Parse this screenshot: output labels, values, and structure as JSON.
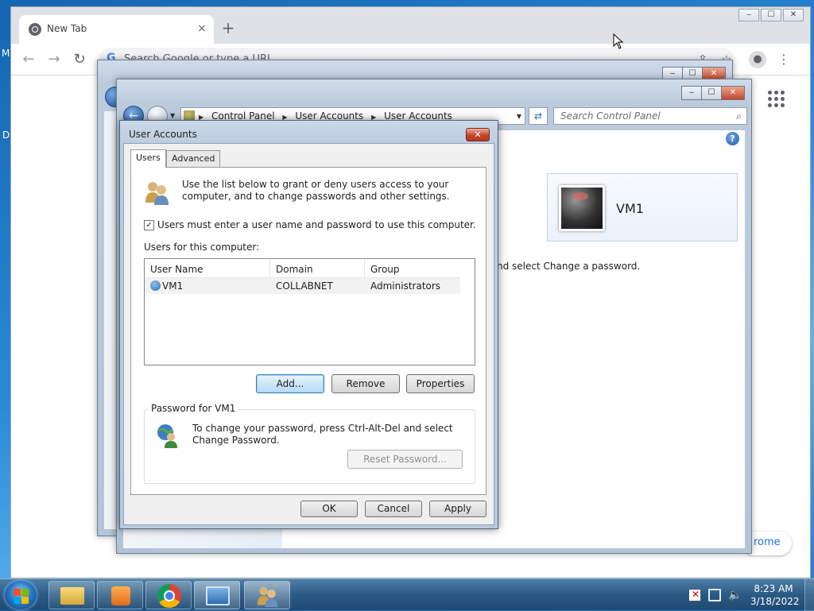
{
  "desktop": {
    "edge_letters": [
      "M",
      "D"
    ]
  },
  "browser": {
    "tab_title": "New Tab",
    "tab_close": "×",
    "new_tab": "+",
    "omnibox_placeholder": "Search Google or type a URL",
    "window_buttons": [
      "‒",
      "☐",
      "✕"
    ],
    "bottom_link": "rome"
  },
  "control_panel": {
    "breadcrumbs": [
      "Control Panel",
      "User Accounts",
      "User Accounts"
    ],
    "search_placeholder": "Search Control Panel",
    "user_name": "VM1",
    "password_hint": "nd select Change a password.",
    "window_buttons": [
      "‒",
      "☐",
      "✕"
    ]
  },
  "dialog": {
    "title": "User Accounts",
    "close": "✕",
    "tabs": [
      "Users",
      "Advanced"
    ],
    "active_tab": "Users",
    "intro": "Use the list below to grant or deny users access to your computer, and to change passwords and other settings.",
    "checkbox_label": "Users must enter a user name and password to use this computer.",
    "checkbox_checked": true,
    "users_label": "Users for this computer:",
    "columns": [
      "User Name",
      "Domain",
      "Group"
    ],
    "rows": [
      {
        "user": "VM1",
        "domain": "COLLABNET",
        "group": "Administrators"
      }
    ],
    "add_button": "Add...",
    "remove_button": "Remove",
    "properties_button": "Properties",
    "password_group_label": "Password for VM1",
    "password_text": "To change your password, press Ctrl-Alt-Del and select Change Password.",
    "reset_button": "Reset Password...",
    "ok_button": "OK",
    "cancel_button": "Cancel",
    "apply_button": "Apply"
  },
  "taskbar": {
    "time": "8:23 AM",
    "date": "3/18/2022",
    "pinned": [
      "file-explorer",
      "media-player",
      "chrome",
      "control-panel",
      "user-accounts"
    ]
  }
}
